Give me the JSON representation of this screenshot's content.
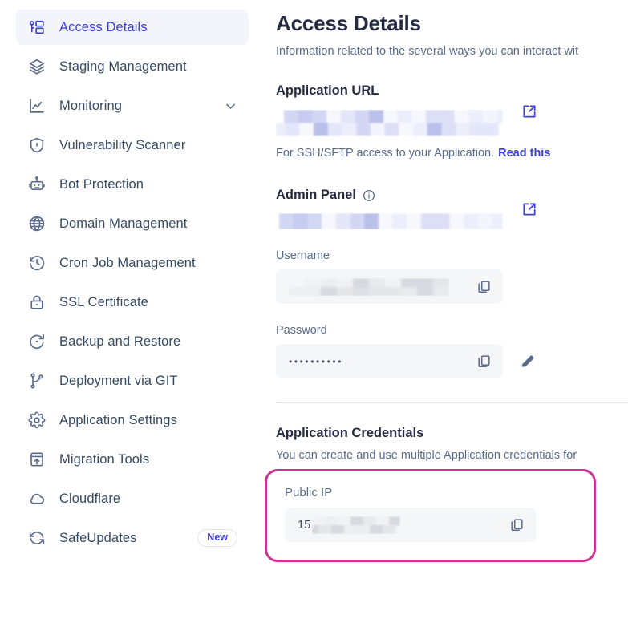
{
  "colors": {
    "accent_blue": "#3b3fd8",
    "highlight_pink": "#cc3392",
    "text_dark": "#242b42",
    "text_muted": "#5a6b8c",
    "field_bg": "#f5f6f8",
    "active_nav_bg": "#f4f5fb"
  },
  "sidebar": {
    "items": [
      {
        "label": "Access Details",
        "icon": "key-card-icon",
        "active": true,
        "chevron": false,
        "badge": null
      },
      {
        "label": "Staging Management",
        "icon": "layers-icon",
        "active": false,
        "chevron": false,
        "badge": null
      },
      {
        "label": "Monitoring",
        "icon": "chart-line-icon",
        "active": false,
        "chevron": true,
        "badge": null
      },
      {
        "label": "Vulnerability Scanner",
        "icon": "shield-warning-icon",
        "active": false,
        "chevron": false,
        "badge": null
      },
      {
        "label": "Bot Protection",
        "icon": "robot-icon",
        "active": false,
        "chevron": false,
        "badge": null
      },
      {
        "label": "Domain Management",
        "icon": "globe-www-icon",
        "active": false,
        "chevron": false,
        "badge": null
      },
      {
        "label": "Cron Job Management",
        "icon": "clock-history-icon",
        "active": false,
        "chevron": false,
        "badge": null
      },
      {
        "label": "SSL Certificate",
        "icon": "lock-icon",
        "active": false,
        "chevron": false,
        "badge": null
      },
      {
        "label": "Backup and Restore",
        "icon": "restore-arrow-icon",
        "active": false,
        "chevron": false,
        "badge": null
      },
      {
        "label": "Deployment via GIT",
        "icon": "git-branch-icon",
        "active": false,
        "chevron": false,
        "badge": null
      },
      {
        "label": "Application Settings",
        "icon": "gear-icon",
        "active": false,
        "chevron": false,
        "badge": null
      },
      {
        "label": "Migration Tools",
        "icon": "migration-upload-icon",
        "active": false,
        "chevron": false,
        "badge": null
      },
      {
        "label": "Cloudflare",
        "icon": "cloud-icon",
        "active": false,
        "chevron": false,
        "badge": null
      },
      {
        "label": "SafeUpdates",
        "icon": "refresh-sync-icon",
        "active": false,
        "chevron": false,
        "badge": "New"
      }
    ]
  },
  "main": {
    "title": "Access Details",
    "subtitle": "Information related to the several ways you can interact wit",
    "application_url": {
      "heading": "Application URL",
      "value_redacted": true,
      "external_link_icon": "external-link-icon",
      "hint_text": "For SSH/SFTP access to your Application.",
      "hint_link": "Read this"
    },
    "admin_panel": {
      "heading": "Admin Panel",
      "info_icon": "info-circle-icon",
      "url_redacted": true,
      "external_link_icon": "external-link-icon",
      "username": {
        "label": "Username",
        "value_redacted": true,
        "copy_icon": "copy-icon"
      },
      "password": {
        "label": "Password",
        "value": "••••••••••",
        "copy_icon": "copy-icon",
        "edit_icon": "pencil-edit-icon"
      }
    },
    "application_credentials": {
      "heading": "Application Credentials",
      "description": "You can create and use multiple Application credentials for",
      "public_ip": {
        "label": "Public IP",
        "value_prefix": "15",
        "value_redacted": true,
        "copy_icon": "copy-icon",
        "highlighted": true
      }
    }
  }
}
